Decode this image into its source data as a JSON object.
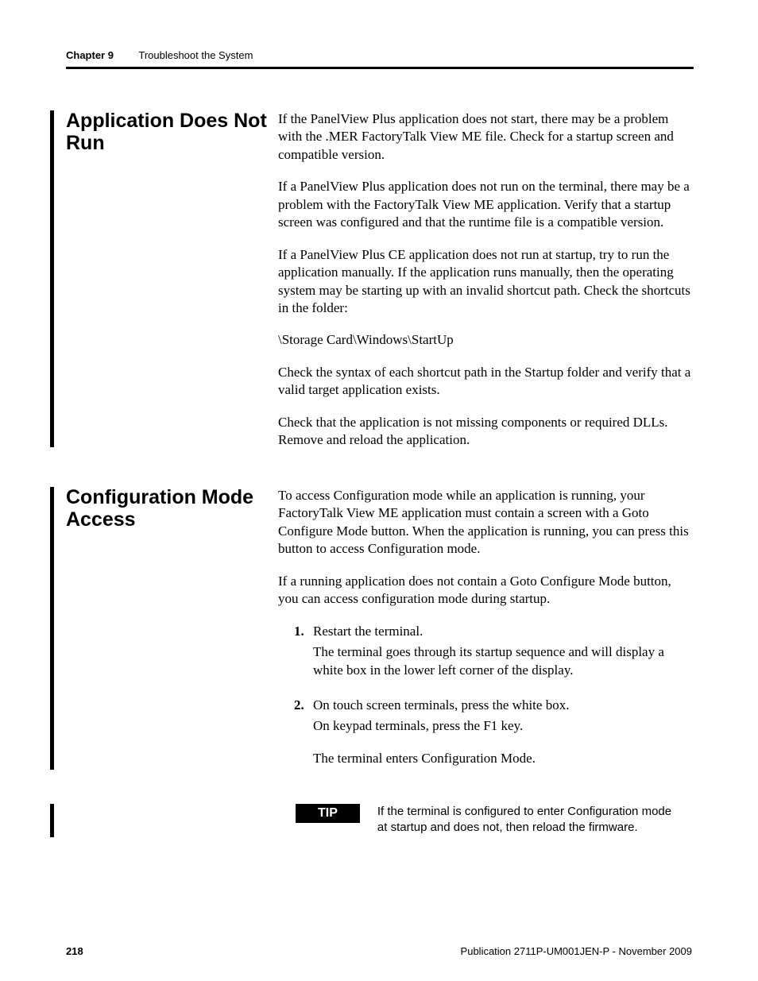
{
  "header": {
    "chapter": "Chapter 9",
    "title": "Troubleshoot the System"
  },
  "sections": [
    {
      "heading": "Application Does Not Run",
      "paragraphs": [
        "If the PanelView Plus application does not start, there may be a problem with the .MER FactoryTalk View ME file. Check for a startup screen and compatible version.",
        "If a PanelView Plus application does not run on the terminal, there may be a problem with the FactoryTalk View ME application. Verify that a startup screen was configured and that the runtime file is a compatible version.",
        "If a PanelView Plus CE application does not run at startup, try to run the application manually. If the application runs manually, then the operating system may be starting up with an invalid shortcut path. Check the shortcuts in the folder:"
      ],
      "path": "\\Storage Card\\Windows\\StartUp",
      "paragraphs_after": [
        "Check the syntax of each shortcut path in the Startup folder and verify that a valid target application exists.",
        "Check that the application is not missing components or required DLLs. Remove and reload the application."
      ]
    },
    {
      "heading": "Configuration Mode Access",
      "paragraphs": [
        "To access Configuration mode while an application is running, your FactoryTalk View ME application must contain a screen with a Goto Configure Mode button. When the application is running, you can press this button to access Configuration mode.",
        "If a running application does not contain a Goto Configure Mode button, you can access configuration mode during startup."
      ],
      "steps": [
        {
          "num": "1.",
          "lead": "Restart the terminal.",
          "trail": "The terminal goes through its startup sequence and will display a white box in the lower left corner of the display."
        },
        {
          "num": "2.",
          "lead": "On touch screen terminals, press the white box.",
          "trail": "On keypad terminals, press the F1 key.",
          "trail2": "The terminal enters Configuration Mode."
        }
      ],
      "tip": {
        "label": "TIP",
        "text": "If the terminal is configured to enter Configuration mode at startup and does not, then reload the firmware."
      }
    }
  ],
  "footer": {
    "page": "218",
    "pub": "Publication 2711P-UM001JEN-P - November 2009"
  }
}
